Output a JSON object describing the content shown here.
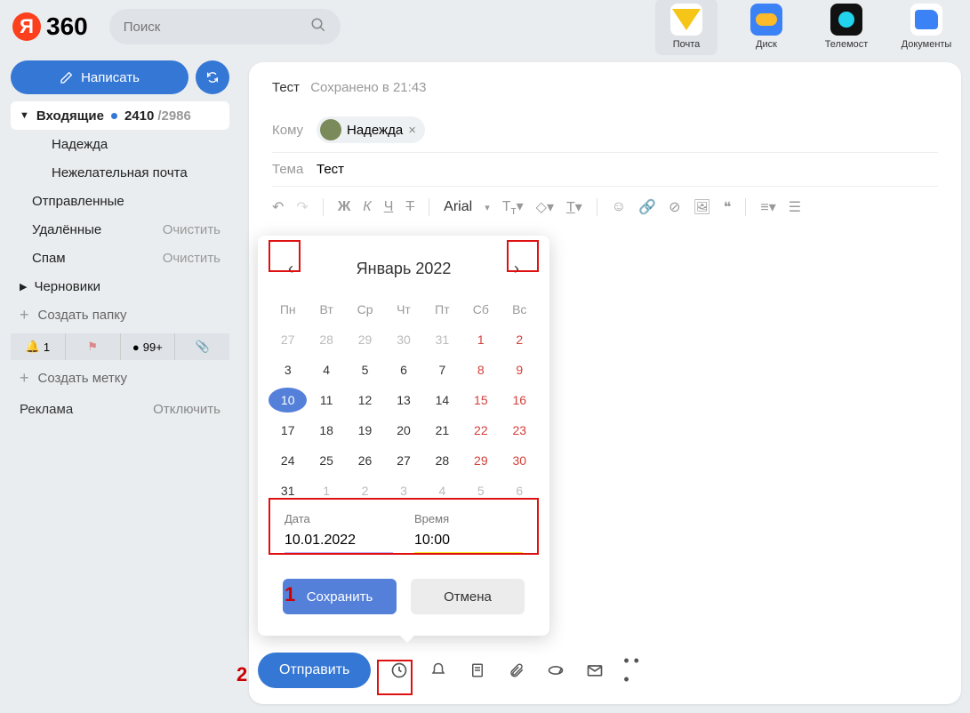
{
  "logo": "360",
  "search": {
    "placeholder": "Поиск"
  },
  "apps": {
    "mail": "Почта",
    "disk": "Диск",
    "tele": "Телемост",
    "docs": "Документы"
  },
  "compose_label": "Написать",
  "sidebar": {
    "inbox": "Входящие",
    "inbox_unread": "2410",
    "inbox_total": "/2986",
    "nadezhda": "Надежда",
    "spam_folder": "Нежелательная почта",
    "sent": "Отправленные",
    "deleted": "Удалённые",
    "spam": "Спам",
    "drafts": "Черновики",
    "clear": "Очистить",
    "create_folder": "Создать папку",
    "create_label": "Создать метку",
    "badge_bell": "1",
    "badge_count": "99+"
  },
  "ad": {
    "label": "Реклама",
    "off": "Отключить"
  },
  "draft": {
    "title": "Тест",
    "saved": "Сохранено в 21:43",
    "to_label": "Кому",
    "recipient": "Надежда",
    "subject_label": "Тема",
    "subject": "Тест"
  },
  "toolbar": {
    "font": "Arial",
    "bold": "Ж",
    "italic": "К",
    "underline": "Ч",
    "strike": "Т"
  },
  "picker": {
    "month": "Январь 2022",
    "dow": [
      "Пн",
      "Вт",
      "Ср",
      "Чт",
      "Пт",
      "Сб",
      "Вс"
    ],
    "weeks": [
      [
        {
          "d": "27",
          "o": 1
        },
        {
          "d": "28",
          "o": 1
        },
        {
          "d": "29",
          "o": 1
        },
        {
          "d": "30",
          "o": 1
        },
        {
          "d": "31",
          "o": 1
        },
        {
          "d": "1",
          "w": 1
        },
        {
          "d": "2",
          "w": 1
        }
      ],
      [
        {
          "d": "3"
        },
        {
          "d": "4"
        },
        {
          "d": "5"
        },
        {
          "d": "6"
        },
        {
          "d": "7"
        },
        {
          "d": "8",
          "w": 1
        },
        {
          "d": "9",
          "w": 1
        }
      ],
      [
        {
          "d": "10",
          "s": 1
        },
        {
          "d": "11"
        },
        {
          "d": "12"
        },
        {
          "d": "13"
        },
        {
          "d": "14"
        },
        {
          "d": "15",
          "w": 1
        },
        {
          "d": "16",
          "w": 1
        }
      ],
      [
        {
          "d": "17"
        },
        {
          "d": "18"
        },
        {
          "d": "19"
        },
        {
          "d": "20"
        },
        {
          "d": "21"
        },
        {
          "d": "22",
          "w": 1
        },
        {
          "d": "23",
          "w": 1
        }
      ],
      [
        {
          "d": "24"
        },
        {
          "d": "25"
        },
        {
          "d": "26"
        },
        {
          "d": "27"
        },
        {
          "d": "28"
        },
        {
          "d": "29",
          "w": 1
        },
        {
          "d": "30",
          "w": 1
        }
      ],
      [
        {
          "d": "31"
        },
        {
          "d": "1",
          "o": 1
        },
        {
          "d": "2",
          "o": 1
        },
        {
          "d": "3",
          "o": 1
        },
        {
          "d": "4",
          "o": 1
        },
        {
          "d": "5",
          "o": 1
        },
        {
          "d": "6",
          "o": 1
        }
      ]
    ],
    "date_label": "Дата",
    "date_value": "10.01.2022",
    "time_label": "Время",
    "time_value": "10:00",
    "save": "Сохранить",
    "cancel": "Отмена"
  },
  "send": "Отправить",
  "ann": {
    "one": "1",
    "two": "2"
  }
}
